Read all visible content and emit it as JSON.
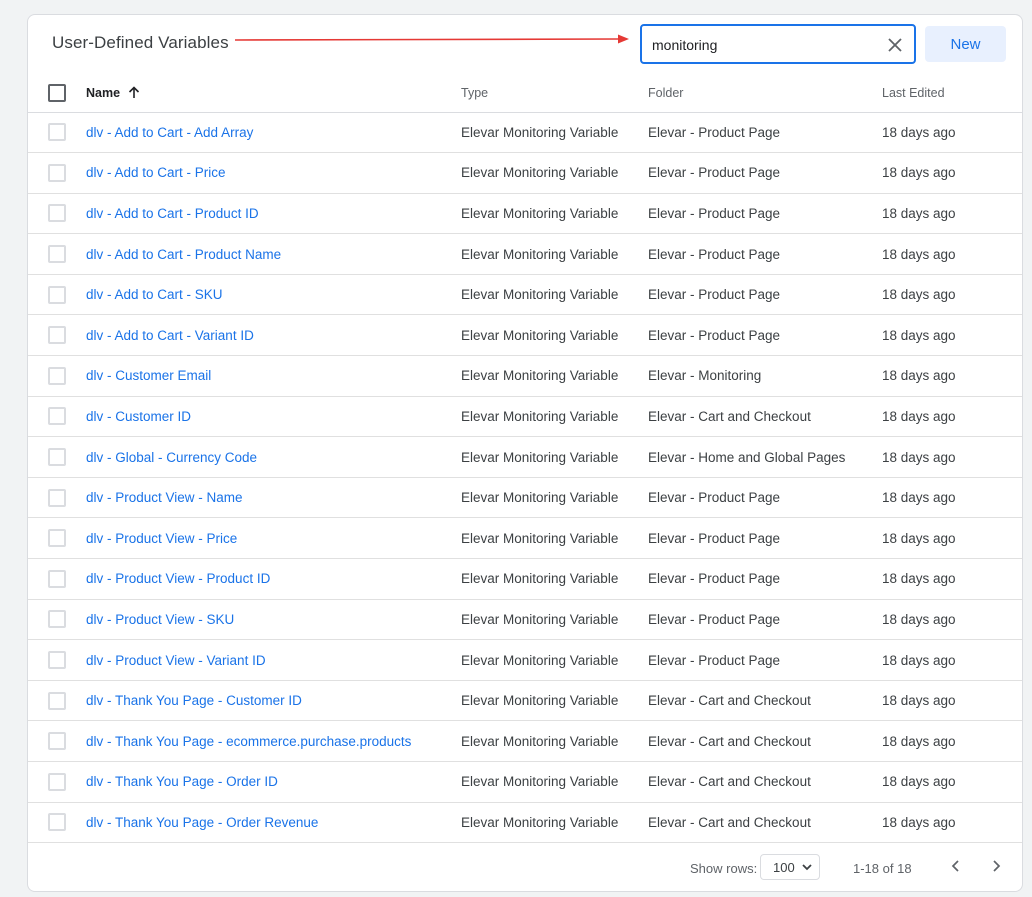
{
  "header": {
    "title": "User-Defined Variables",
    "search_value": "monitoring",
    "new_label": "New",
    "annotation_color": "#e53935"
  },
  "columns": {
    "name": "Name",
    "type": "Type",
    "folder": "Folder",
    "last_edited": "Last Edited"
  },
  "sort": {
    "column": "name",
    "direction": "ascending",
    "icon": "arrow-up-icon"
  },
  "rows": [
    {
      "name": "dlv - Add to Cart - Add Array",
      "type": "Elevar Monitoring Variable",
      "folder": "Elevar - Product Page",
      "edited": "18 days ago"
    },
    {
      "name": "dlv - Add to Cart - Price",
      "type": "Elevar Monitoring Variable",
      "folder": "Elevar - Product Page",
      "edited": "18 days ago"
    },
    {
      "name": "dlv - Add to Cart - Product ID",
      "type": "Elevar Monitoring Variable",
      "folder": "Elevar - Product Page",
      "edited": "18 days ago"
    },
    {
      "name": "dlv - Add to Cart - Product Name",
      "type": "Elevar Monitoring Variable",
      "folder": "Elevar - Product Page",
      "edited": "18 days ago"
    },
    {
      "name": "dlv - Add to Cart - SKU",
      "type": "Elevar Monitoring Variable",
      "folder": "Elevar - Product Page",
      "edited": "18 days ago"
    },
    {
      "name": "dlv - Add to Cart - Variant ID",
      "type": "Elevar Monitoring Variable",
      "folder": "Elevar - Product Page",
      "edited": "18 days ago"
    },
    {
      "name": "dlv - Customer Email",
      "type": "Elevar Monitoring Variable",
      "folder": "Elevar - Monitoring",
      "edited": "18 days ago"
    },
    {
      "name": "dlv - Customer ID",
      "type": "Elevar Monitoring Variable",
      "folder": "Elevar - Cart and Checkout",
      "edited": "18 days ago"
    },
    {
      "name": "dlv - Global - Currency Code",
      "type": "Elevar Monitoring Variable",
      "folder": "Elevar - Home and Global Pages",
      "edited": "18 days ago"
    },
    {
      "name": "dlv - Product View - Name",
      "type": "Elevar Monitoring Variable",
      "folder": "Elevar - Product Page",
      "edited": "18 days ago"
    },
    {
      "name": "dlv - Product View - Price",
      "type": "Elevar Monitoring Variable",
      "folder": "Elevar - Product Page",
      "edited": "18 days ago"
    },
    {
      "name": "dlv - Product View - Product ID",
      "type": "Elevar Monitoring Variable",
      "folder": "Elevar - Product Page",
      "edited": "18 days ago"
    },
    {
      "name": "dlv - Product View - SKU",
      "type": "Elevar Monitoring Variable",
      "folder": "Elevar - Product Page",
      "edited": "18 days ago"
    },
    {
      "name": "dlv - Product View - Variant ID",
      "type": "Elevar Monitoring Variable",
      "folder": "Elevar - Product Page",
      "edited": "18 days ago"
    },
    {
      "name": "dlv - Thank You Page - Customer ID",
      "type": "Elevar Monitoring Variable",
      "folder": "Elevar - Cart and Checkout",
      "edited": "18 days ago"
    },
    {
      "name": "dlv - Thank You Page - ecommerce.purchase.products",
      "type": "Elevar Monitoring Variable",
      "folder": "Elevar - Cart and Checkout",
      "edited": "18 days ago"
    },
    {
      "name": "dlv - Thank You Page - Order ID",
      "type": "Elevar Monitoring Variable",
      "folder": "Elevar - Cart and Checkout",
      "edited": "18 days ago"
    },
    {
      "name": "dlv - Thank You Page - Order Revenue",
      "type": "Elevar Monitoring Variable",
      "folder": "Elevar - Cart and Checkout",
      "edited": "18 days ago"
    }
  ],
  "footer": {
    "rows_label": "Show rows:",
    "rows_value": "100",
    "range": "1-18 of 18"
  },
  "colors": {
    "link": "#1a73e8",
    "focus_border": "#1a73e8",
    "new_button_bg": "#e8f0fe"
  }
}
